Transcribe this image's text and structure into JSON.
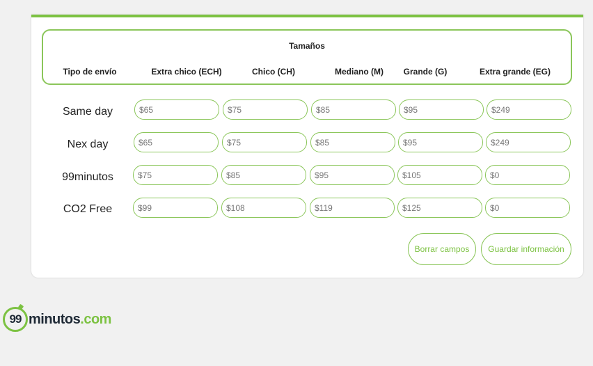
{
  "header": {
    "sizes_title": "Tamaños",
    "ship_type_label": "Tipo de envío",
    "columns": [
      "Extra chico (ECH)",
      "Chico (CH)",
      "Mediano (M)",
      "Grande (G)",
      "Extra grande (EG)"
    ]
  },
  "rows": [
    {
      "label": "Same day",
      "prices": [
        "$65",
        "$75",
        "$85",
        "$95",
        "$249"
      ]
    },
    {
      "label": "Nex day",
      "prices": [
        "$65",
        "$75",
        "$85",
        "$95",
        "$249"
      ]
    },
    {
      "label": "99minutos",
      "prices": [
        "$75",
        "$85",
        "$95",
        "$105",
        "$0"
      ]
    },
    {
      "label": "CO2 Free",
      "prices": [
        "$99",
        "$108",
        "$119",
        "$125",
        "$0"
      ]
    }
  ],
  "actions": {
    "clear_label": "Borrar campos",
    "save_label": "Guardar información"
  },
  "logo": {
    "prefix": "99",
    "word": "minutos",
    "suffix": ".com"
  },
  "colors": {
    "accent": "#7cc242",
    "background": "#f1f1f1",
    "card": "#ffffff"
  }
}
